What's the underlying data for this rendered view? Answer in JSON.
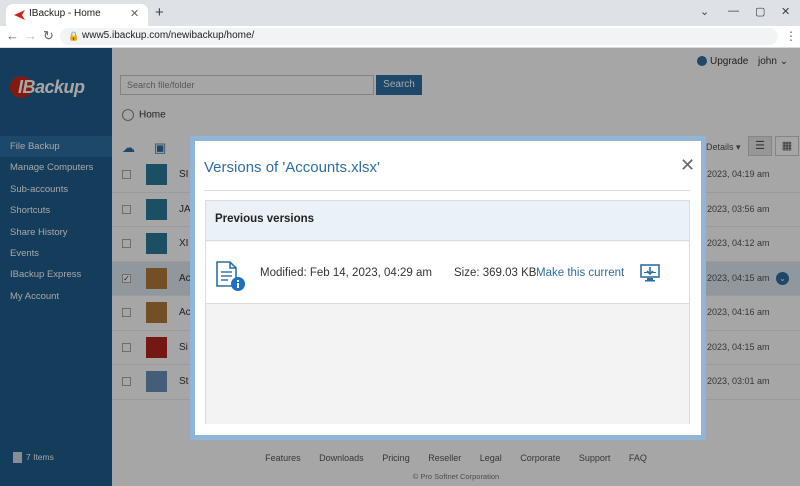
{
  "browser": {
    "tab_title": "IBackup - Home",
    "url": "www5.ibackup.com/newibackup/home/"
  },
  "app": {
    "logo_text": "IBackup",
    "upgrade_label": "Upgrade",
    "user_name": "john",
    "search_placeholder": "Search file/folder",
    "search_button": "Search",
    "breadcrumb": "Home",
    "details_label": "Details",
    "sidebar": {
      "items": [
        {
          "label": "File Backup"
        },
        {
          "label": "Manage Computers"
        },
        {
          "label": "Sub-accounts"
        },
        {
          "label": "Shortcuts"
        },
        {
          "label": "Share History"
        },
        {
          "label": "Events"
        },
        {
          "label": "IBackup Express"
        },
        {
          "label": "My Account"
        }
      ],
      "items_count": "7 Items"
    },
    "file_rows": [
      {
        "name": "SI",
        "date": ", 2023, 04:19 am"
      },
      {
        "name": "JA",
        "date": ", 2023, 03:56 am"
      },
      {
        "name": "XI",
        "date": ", 2023, 04:12 am"
      },
      {
        "name": "Ac",
        "date": ", 2023, 04:15 am"
      },
      {
        "name": "Ac",
        "date": ", 2023, 04:16 am"
      },
      {
        "name": "Si",
        "date": ", 2023, 04:15 am"
      },
      {
        "name": "St",
        "date": ", 2023, 03:01 am"
      }
    ],
    "footer_links": [
      "Features",
      "Downloads",
      "Pricing",
      "Reseller",
      "Legal",
      "Corporate",
      "Support",
      "FAQ"
    ],
    "copyright": "© Pro Softnet Corporation"
  },
  "modal": {
    "title": "Versions of 'Accounts.xlsx'",
    "section_heading": "Previous versions",
    "version": {
      "modified": "Modified: Feb 14, 2023, 04:29 am",
      "size": "Size: 369.03 KB",
      "make_current": "Make this current"
    }
  },
  "colors": {
    "brand_blue": "#2d6fa4",
    "sidebar_bg": "#1f5c8c",
    "modal_border": "#8fb6d6"
  },
  "icons": [
    "close-icon",
    "document-info-icon",
    "restore-to-computer-icon",
    "upload-icon",
    "new-folder-icon",
    "list-view-icon",
    "grid-view-icon"
  ]
}
